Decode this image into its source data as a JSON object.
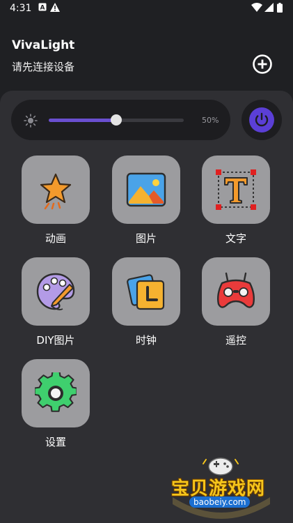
{
  "status_bar": {
    "time": "4:31"
  },
  "header": {
    "title": "VivaLight",
    "subtitle": "请先连接设备"
  },
  "brightness": {
    "value": "50%",
    "level": 0.5
  },
  "tiles": [
    {
      "label": "动画",
      "icon": "star-icon"
    },
    {
      "label": "图片",
      "icon": "picture-icon"
    },
    {
      "label": "文字",
      "icon": "text-icon"
    },
    {
      "label": "DIY图片",
      "icon": "palette-icon"
    },
    {
      "label": "时钟",
      "icon": "clock-icon"
    },
    {
      "label": "遥控",
      "icon": "gamepad-icon"
    },
    {
      "label": "设置",
      "icon": "gear-icon"
    }
  ],
  "watermark": {
    "text": "宝贝游戏网",
    "url": "baobeiy.com"
  },
  "colors": {
    "accent": "#5b3fd6",
    "tile": "#9c9c9f",
    "panel": "#2f2f33"
  }
}
